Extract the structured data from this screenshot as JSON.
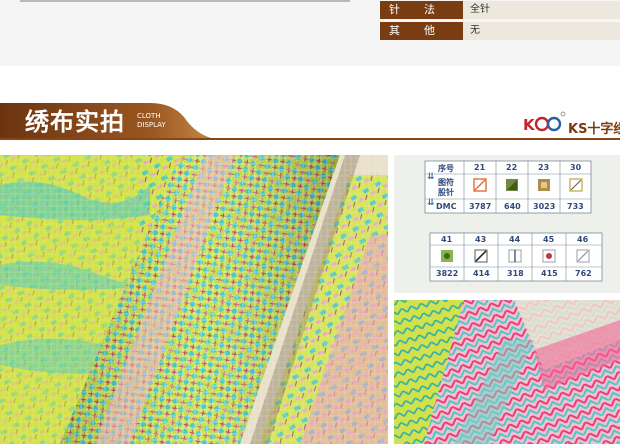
{
  "spec": {
    "rows": [
      {
        "key": "针法",
        "value": "全针"
      },
      {
        "key": "其他",
        "value": "无"
      }
    ]
  },
  "banner": {
    "title": "绣布实拍",
    "subtitle_line1": "CLOTH",
    "subtitle_line2": "DISPLAY",
    "logo_text": "KS十字绣"
  },
  "chart": {
    "row_labels": [
      "序号",
      "图符",
      "股针",
      "DMC"
    ],
    "side_arrows": [
      "⇊",
      "⇊"
    ],
    "table1": {
      "numbers": [
        "21",
        "22",
        "23",
        "30"
      ],
      "dmc": [
        "3787",
        "640",
        "3023",
        "733"
      ],
      "colors": [
        "#e06b3a",
        "#6f8a3c",
        "#b08b4e",
        "#c9b255"
      ]
    },
    "table2": {
      "numbers": [
        "41",
        "43",
        "44",
        "45",
        "46"
      ],
      "dmc": [
        "3822",
        "414",
        "318",
        "415",
        "762"
      ],
      "colors": [
        "#8bb34f",
        "#5a5a5a",
        "#9aa0a6",
        "#c0383f",
        "#c8ccd0"
      ]
    }
  },
  "colors": {
    "brand_brown": "#7a3c12",
    "fabric_lime": "#c9dd3e",
    "fabric_teal": "#38c6c0",
    "fabric_pink": "#e889b7"
  }
}
